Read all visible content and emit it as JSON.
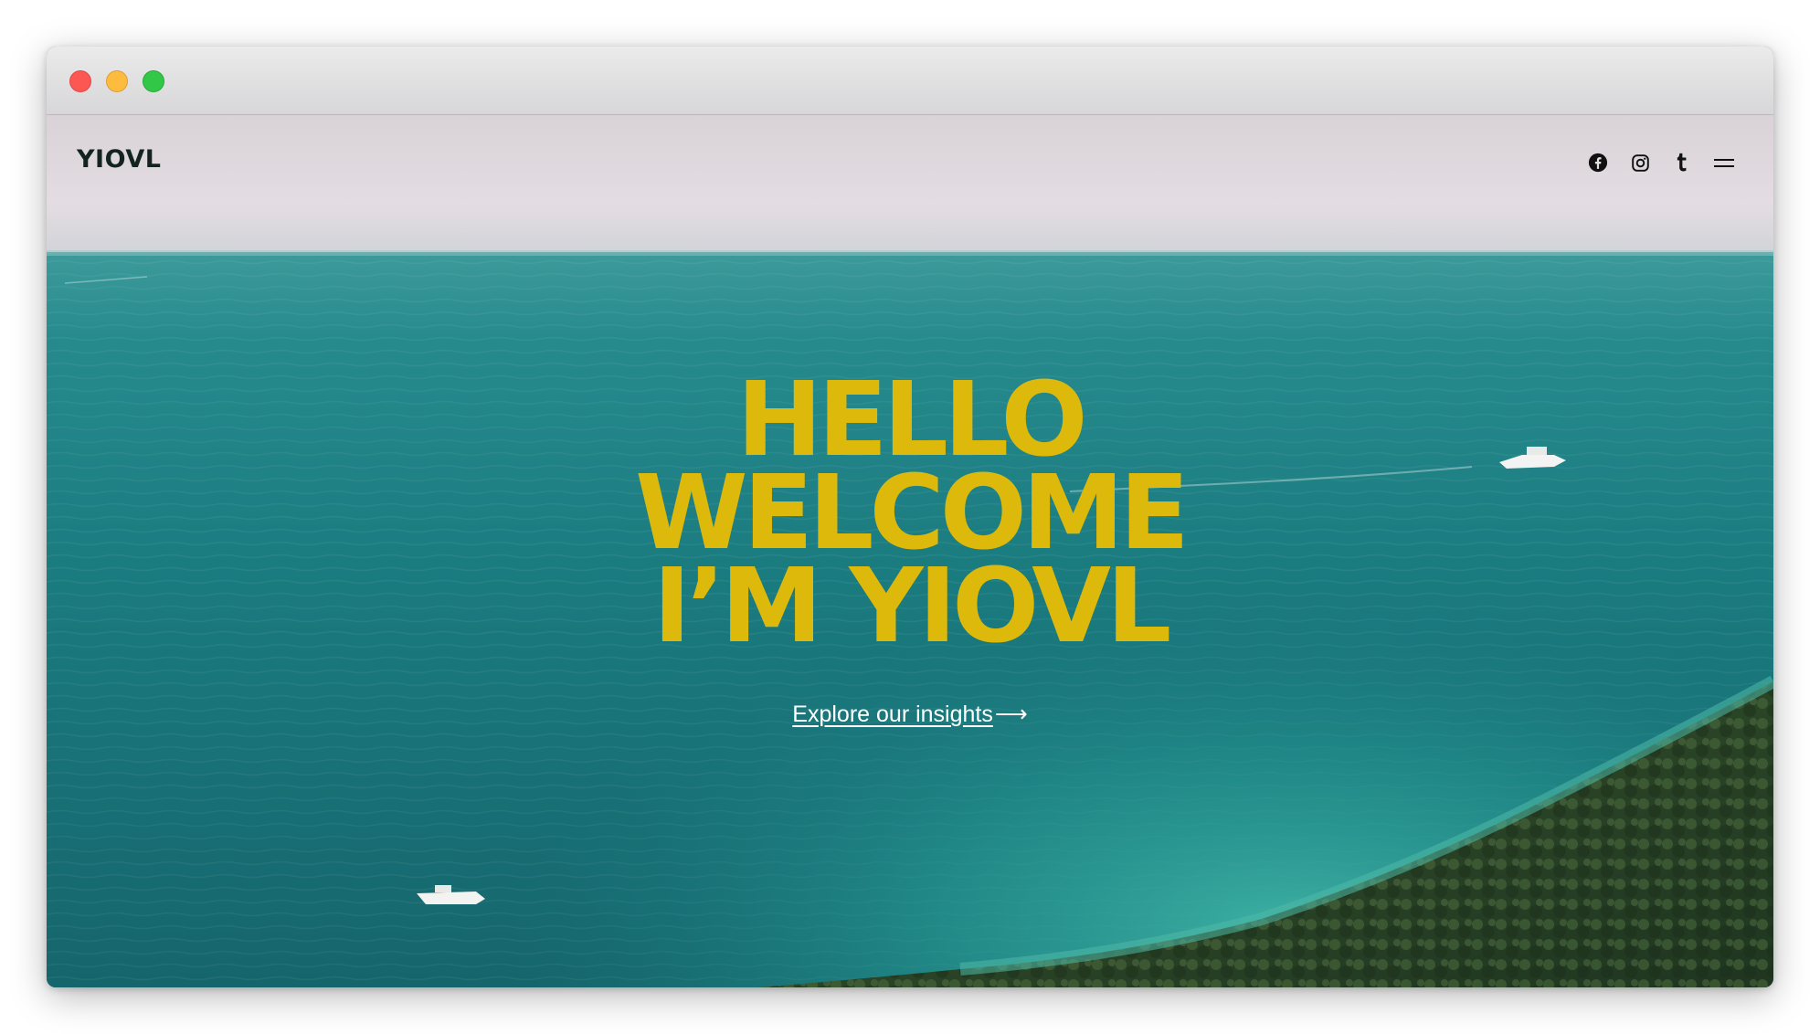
{
  "window": {
    "controls": [
      "close",
      "minimize",
      "zoom"
    ]
  },
  "header": {
    "logo": "YIOVL",
    "icons": [
      "facebook-icon",
      "instagram-icon",
      "tumblr-icon",
      "menu-icon"
    ]
  },
  "hero": {
    "line1": "HELLO",
    "line2": "WELCOME",
    "line3": "I’M YIOVL",
    "cta_label": "Explore our insights",
    "cta_arrow": "⟶"
  },
  "colors": {
    "headline": "#ddb90c",
    "logo": "#13241f",
    "cta": "#ffffff",
    "sea": "#1a7d80"
  }
}
